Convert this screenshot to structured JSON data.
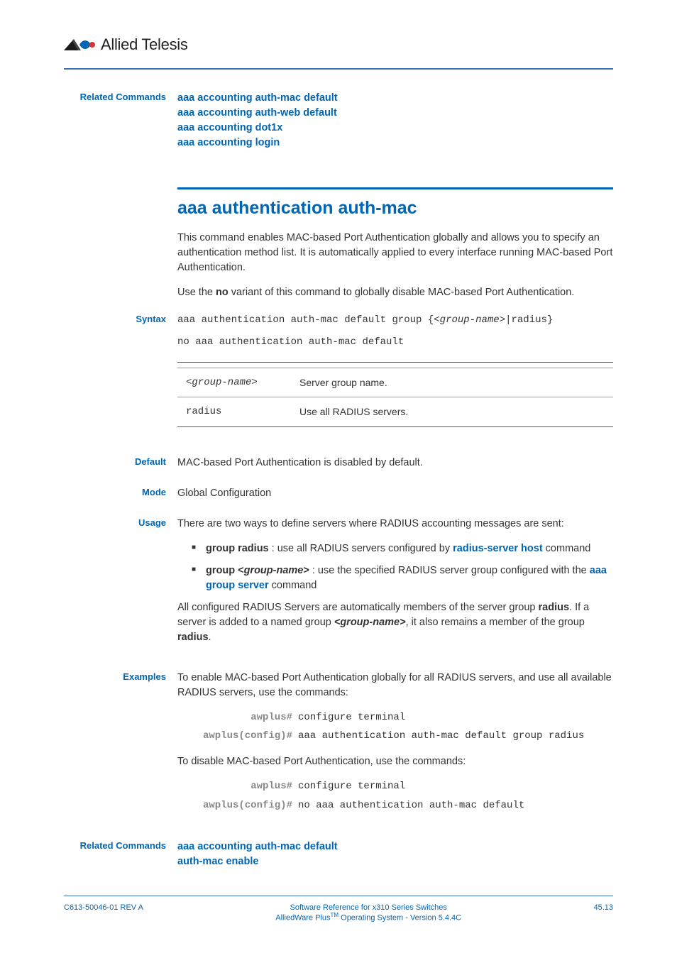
{
  "brand": "Allied Telesis",
  "related_top": {
    "label": "Related Commands",
    "links": [
      "aaa accounting auth-mac default",
      "aaa accounting auth-web default",
      "aaa accounting dot1x",
      "aaa accounting login"
    ]
  },
  "title": "aaa authentication auth-mac",
  "intro1": "This command enables MAC-based Port Authentication globally and allows you to specify an authentication method list. It is automatically applied to every interface running MAC-based Port Authentication.",
  "intro2a": "Use the ",
  "intro2b": "no",
  "intro2c": " variant of this command to globally disable MAC-based Port Authentication.",
  "syntax": {
    "label": "Syntax",
    "line1a": "aaa authentication auth-mac default group {<",
    "line1b": "group-name",
    "line1c": ">|radius}",
    "line2": "no aaa authentication auth-mac default"
  },
  "params": [
    {
      "name": "<group-name>",
      "desc": "Server group name."
    },
    {
      "name": "radius",
      "desc": "Use all RADIUS servers."
    }
  ],
  "default": {
    "label": "Default",
    "text": "MAC-based Port Authentication is disabled by default."
  },
  "mode": {
    "label": "Mode",
    "text": "Global Configuration"
  },
  "usage": {
    "label": "Usage",
    "intro": "There are two ways to define servers where RADIUS accounting messages are sent:",
    "b1a": "group radius",
    "b1b": " : use all RADIUS servers configured by ",
    "b1c": "radius-server host",
    "b1d": " command",
    "b2a": "group <",
    "b2b": "group-name",
    "b2c": ">",
    "b2d": " : use the specified RADIUS server group configured with the ",
    "b2e": "aaa group server",
    "b2f": " command",
    "p2a": "All configured RADIUS Servers are automatically members of the server group ",
    "p2b": "radius",
    "p2c": ". If a server is added to a named group ",
    "p2d": "<group-name>",
    "p2e": ", it also remains a member of the group ",
    "p2f": "radius",
    "p2g": "."
  },
  "examples": {
    "label": "Examples",
    "p1": "To enable MAC-based Port Authentication globally for all RADIUS servers, and use all available RADIUS servers, use the commands:",
    "cli1": [
      {
        "prompt": "awplus#",
        "cmd": "configure terminal"
      },
      {
        "prompt": "awplus(config)#",
        "cmd": "aaa authentication auth-mac default group radius"
      }
    ],
    "p2": "To disable MAC-based Port Authentication, use the commands:",
    "cli2": [
      {
        "prompt": "awplus#",
        "cmd": "configure terminal"
      },
      {
        "prompt": "awplus(config)#",
        "cmd": "no aaa authentication auth-mac default"
      }
    ]
  },
  "related_bottom": {
    "label": "Related Commands",
    "links": [
      "aaa accounting auth-mac default",
      "auth-mac enable"
    ]
  },
  "footer": {
    "left": "C613-50046-01 REV A",
    "line1": "Software Reference for x310 Series Switches",
    "line2a": "AlliedWare Plus",
    "line2b": "TM",
    "line2c": " Operating System - Version 5.4.4C",
    "right": "45.13"
  }
}
